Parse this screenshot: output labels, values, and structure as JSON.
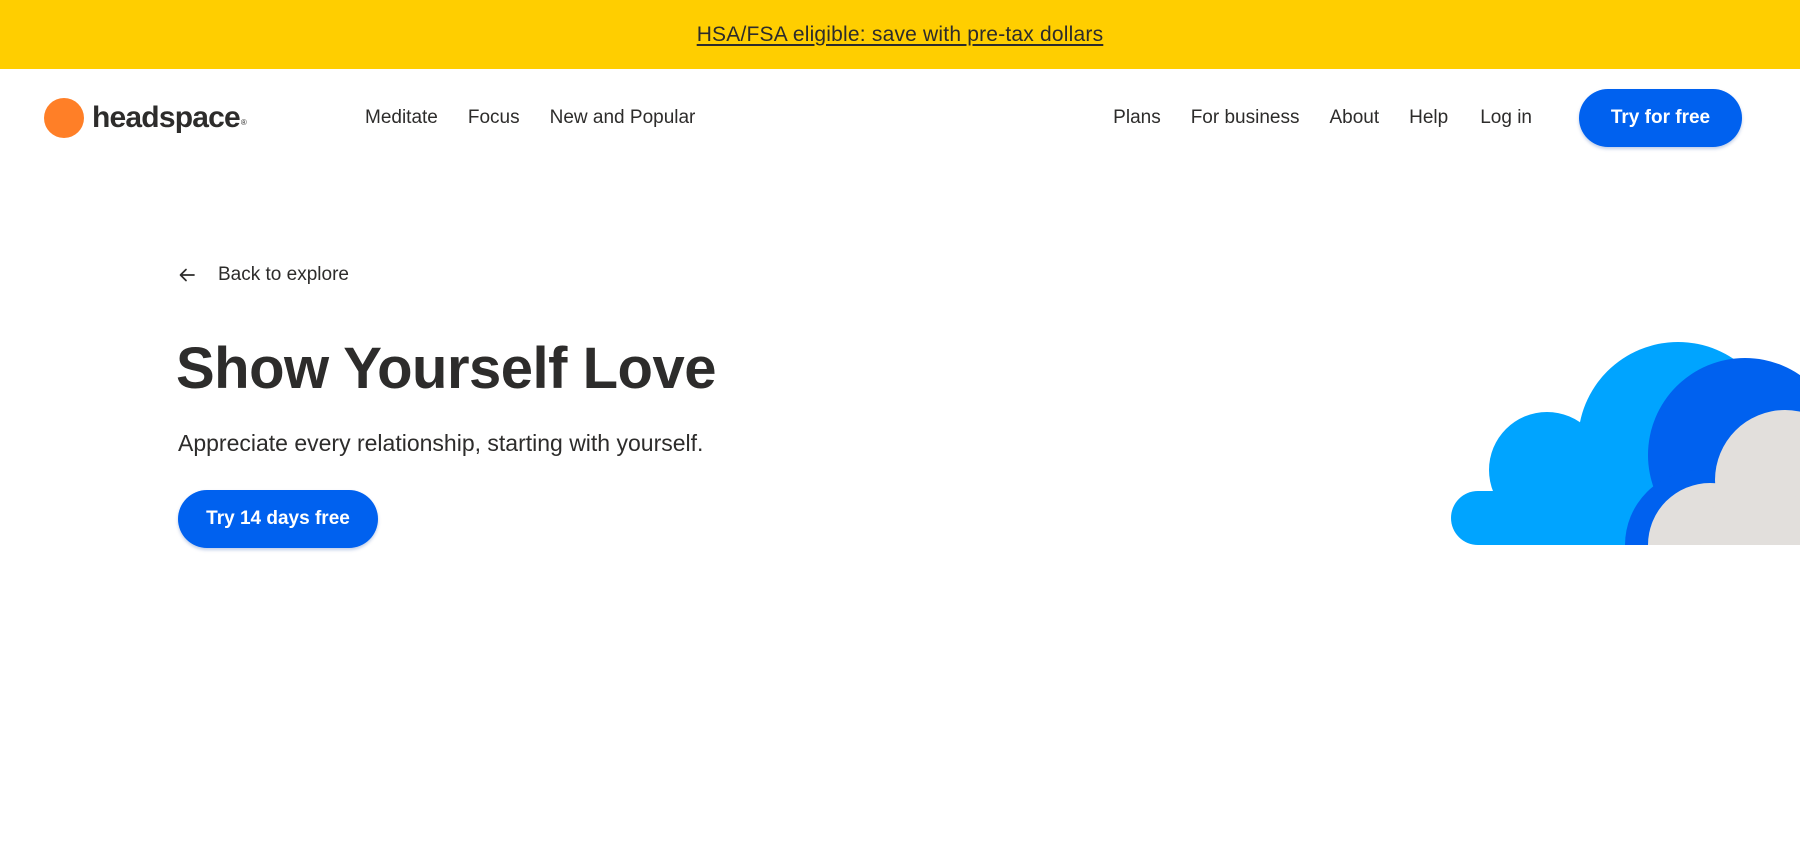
{
  "banner": {
    "text": "HSA/FSA eligible: save with pre-tax dollars",
    "color": "#ffce00"
  },
  "header": {
    "logo_text": "headspace",
    "logo_mark": "®",
    "nav_left": [
      {
        "label": "Meditate"
      },
      {
        "label": "Focus"
      },
      {
        "label": "New and Popular"
      }
    ],
    "nav_right": [
      {
        "label": "Plans"
      },
      {
        "label": "For business"
      },
      {
        "label": "About"
      },
      {
        "label": "Help"
      },
      {
        "label": "Log in"
      }
    ],
    "cta_label": "Try for free"
  },
  "main": {
    "back_label": "Back to explore",
    "back_icon": "arrow-left-icon",
    "title": "Show Yourself Love",
    "subtitle": "Appreciate every relationship, starting with yourself.",
    "cta_label": "Try 14 days free"
  },
  "colors": {
    "brand_orange": "#ff7f27",
    "primary_blue": "#0061ef",
    "cloud_light_blue": "#00a4ff",
    "cloud_dark_blue": "#0061ef",
    "cloud_gray": "#e2dfdc",
    "text": "#2d2c2b"
  }
}
